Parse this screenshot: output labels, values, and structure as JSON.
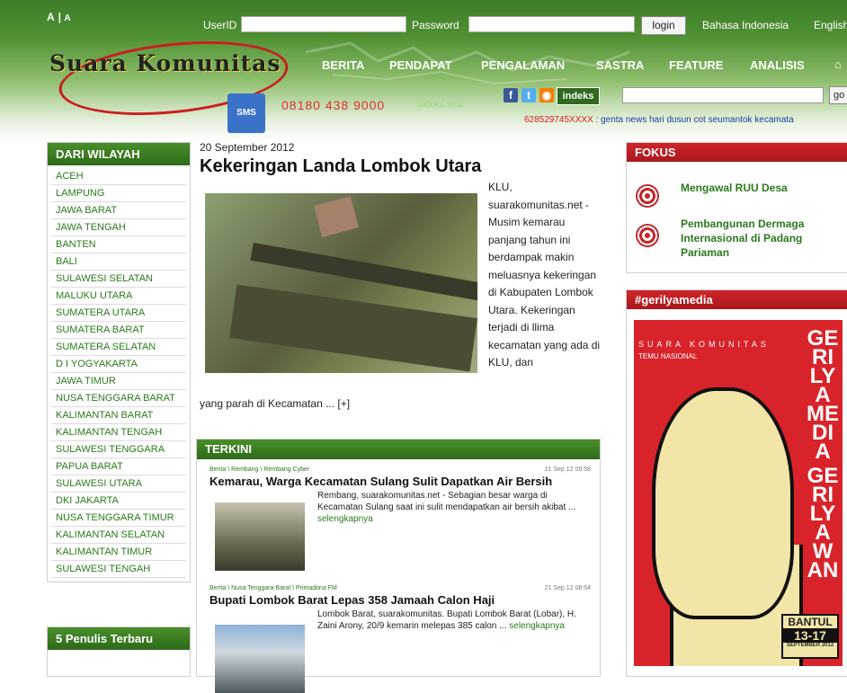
{
  "header": {
    "font_size": {
      "large": "A",
      "small": "A"
    },
    "userid_label": "UserID",
    "password_label": "Password",
    "login_label": "login",
    "languages": [
      "Bahasa Indonesia",
      "English"
    ],
    "logo": "Suara Komunitas",
    "nav": [
      "BERITA",
      "PENDAPAT",
      "PENGALAMAN",
      "SASTRA",
      "FEATURE",
      "ANALISIS"
    ],
    "sms_label": "SMS",
    "phone": "08180 438 9000",
    "indeks_sms": "indeks sms",
    "indeks_button": "indeks",
    "go_label": "go",
    "ticker_number": "628529745XXXX",
    "ticker_text": " : genta news hari dusun cot seumantok kecamata"
  },
  "sidebar": {
    "regions_title": "DARI WILAYAH",
    "regions": [
      "ACEH",
      "LAMPUNG",
      "JAWA BARAT",
      "JAWA TENGAH",
      "BANTEN",
      "BALI",
      "SULAWESI SELATAN",
      "MALUKU UTARA",
      "SUMATERA UTARA",
      "SUMATERA BARAT",
      "SUMATERA SELATAN",
      "D I YOGYAKARTA",
      "JAWA TIMUR",
      "NUSA TENGGARA BARAT",
      "KALIMANTAN BARAT",
      "KALIMANTAN TENGAH",
      "SULAWESI TENGGARA",
      "PAPUA BARAT",
      "SULAWESI UTARA",
      "DKI JAKARTA",
      "NUSA TENGGARA TIMUR",
      "KALIMANTAN SELATAN",
      "KALIMANTAN TIMUR",
      "SULAWESI TENGAH"
    ],
    "writers_title": "5 Penulis Terbaru"
  },
  "featured": {
    "date": "20 September 2012",
    "title": "Kekeringan Landa Lombok Utara",
    "lead": "KLU, suarakomunitas.net - Musim kemarau panjang tahun ini berdampak makin meluasnya kekeringan di Kabupaten Lombok Utara. Kekeringan terjadi di llima kecamatan yang ada di KLU, dan",
    "lead_tail": "yang parah di Kecamatan ... [+]"
  },
  "terkini": {
    "title": "TERKINI",
    "items": [
      {
        "meta": "Berita \\ Rembang \\ Rembang Cyber",
        "time": "21 Sep 12 09:58",
        "headline": "Kemarau, Warga Kecamatan Sulang Sulit Dapatkan Air Bersih",
        "body": "Rembang, suarakomunitas.net - Sebagian besar warga di Kecamatan Sulang saat ini sulit mendapatkan air bersih akibat ...",
        "more": "selengkapnya"
      },
      {
        "meta": "Berita \\ Nusa Tenggara Barat \\ Primadona FM",
        "time": "21 Sep 12 08:54",
        "headline": "Bupati Lombok Barat Lepas 358 Jamaah Calon Haji",
        "body": "Lombok Barat, suarakomunitas. Bupati Lombok Barat (Lobar), H. Zaini Arony, 20/9 kemarin melepas 385 calon ...",
        "more": "selengkapnya"
      }
    ]
  },
  "fokus": {
    "title": "FOKUS",
    "items": [
      "Mengawal RUU Desa",
      "Pembangunan Dermaga Internasional di Padang Pariaman"
    ]
  },
  "gerilya": {
    "title": "#gerilyamedia",
    "tag1": "SUARA KOMUNITAS",
    "tag2": "TEMU NASIONAL",
    "vertical": "GERILYAMEDIA",
    "vertical2": "GERILYAWAN",
    "place": "BANTUL",
    "dates": "13-17",
    "month": "SEPTEMBER 2012"
  },
  "colors": {
    "green": "#2d6a19",
    "red": "#c4262a",
    "link_green": "#2a7a1c"
  }
}
